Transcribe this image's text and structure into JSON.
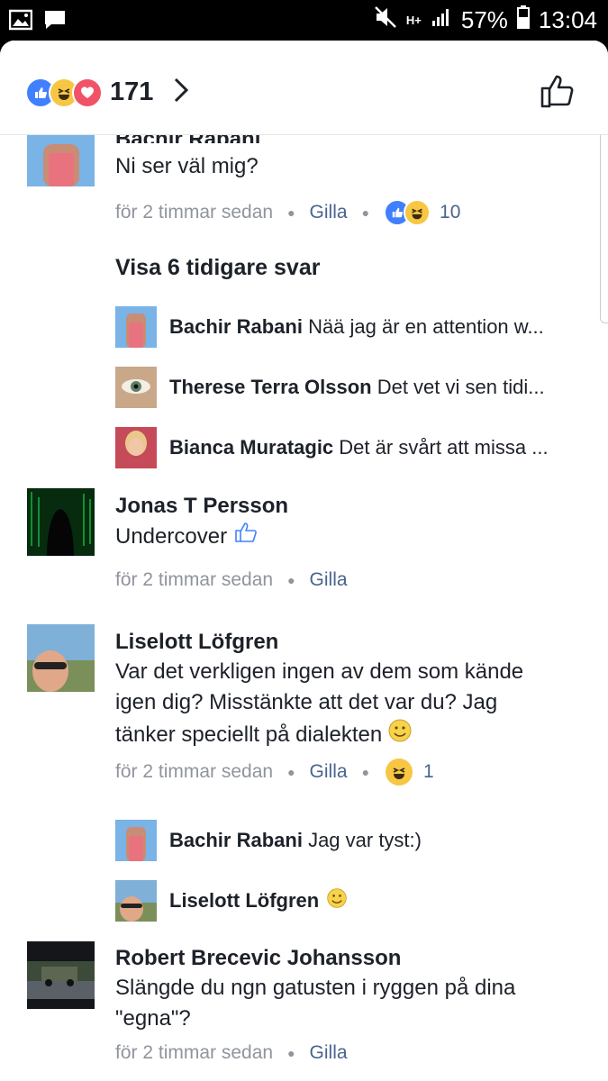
{
  "statusbar": {
    "battery": "57%",
    "time": "13:04",
    "network": "H+"
  },
  "header": {
    "reaction_count": "171",
    "reactions": [
      "like-icon",
      "haha-icon",
      "love-icon"
    ]
  },
  "comments": [
    {
      "name": "Bachir Rabani",
      "body": "Ni ser väl mig?",
      "time": "för 2 timmar sedan",
      "action": "Gilla",
      "reaction_count": "10"
    },
    {
      "name": "Jonas T Persson",
      "body": "Undercover",
      "time": "för 2 timmar sedan",
      "action": "Gilla"
    },
    {
      "name": "Liselott Löfgren",
      "body_lines": [
        "Var det verkligen ingen av dem som kände",
        "igen dig? Misstänkte att det var du? Jag",
        "tänker speciellt på dialekten"
      ],
      "time": "för 2 timmar sedan",
      "action": "Gilla",
      "reaction_count": "1"
    },
    {
      "name": "Robert Brecevic Johansson",
      "body_lines": [
        "Slängde du ngn gatusten i ryggen på dina",
        "\"egna\"?"
      ],
      "time": "för 2 timmar sedan",
      "action": "Gilla"
    }
  ],
  "show_more": "Visa 6 tidigare svar",
  "replies_1": [
    {
      "name": "Bachir Rabani",
      "text": "Nää jag är en attention w..."
    },
    {
      "name": "Therese Terra Olsson",
      "text": "Det vet vi sen tidi..."
    },
    {
      "name": "Bianca Muratagic",
      "text": "Det är svårt att missa ..."
    }
  ],
  "replies_2": [
    {
      "name": "Bachir Rabani",
      "text": "Jag var tyst:)"
    },
    {
      "name": "Liselott Löfgren",
      "text": ""
    }
  ],
  "colors": {
    "like_blue": "#4080ff",
    "haha_yellow": "#f7c744",
    "love_red": "#f25268",
    "link_blue": "#4b6390",
    "meta_gray": "#90949c"
  }
}
